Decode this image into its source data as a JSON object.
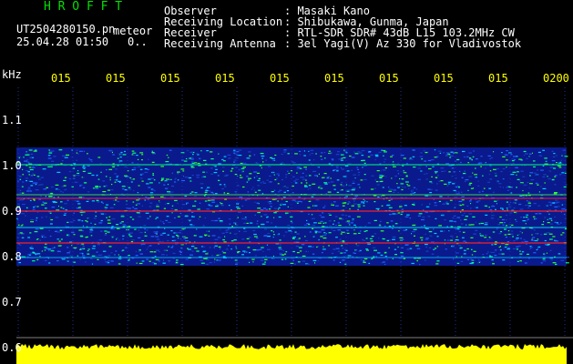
{
  "header": {
    "app_name": "H R O F F T",
    "filename": "UT2504280150.pn",
    "meteor_label": "meteor",
    "datetime": "25.04.28 01:50",
    "count": "0..",
    "info_labels": [
      "Observer",
      "Receiving Location",
      "Receiver",
      "Receiving Antenna"
    ],
    "info_values": [
      ": Masaki Kano",
      ": Shibukawa, Gunma, Japan",
      ": RTL-SDR SDR# 43dB L15 103.2MHz CW",
      ": 3el Yagi(V) Az 330 for Vladivostok"
    ]
  },
  "axis": {
    "unit": "kHz",
    "y_ticks": [
      "1.1",
      "1.0",
      "0.9",
      "0.8",
      "0.7",
      "0.6"
    ],
    "time_labels": [
      "015",
      "015",
      "015",
      "015",
      "015",
      "015",
      "015",
      "015",
      "015",
      "0200"
    ]
  },
  "colors": {
    "background": "#000000",
    "header_text": "#ffffff",
    "time_labels": "#ffff00",
    "app_name": "#00e000",
    "band_noise_low": "#0a1a8c",
    "band_noise_high": "#00ff66",
    "signal_line": "#ff2020",
    "bottom_strip": "#ffff00"
  }
}
